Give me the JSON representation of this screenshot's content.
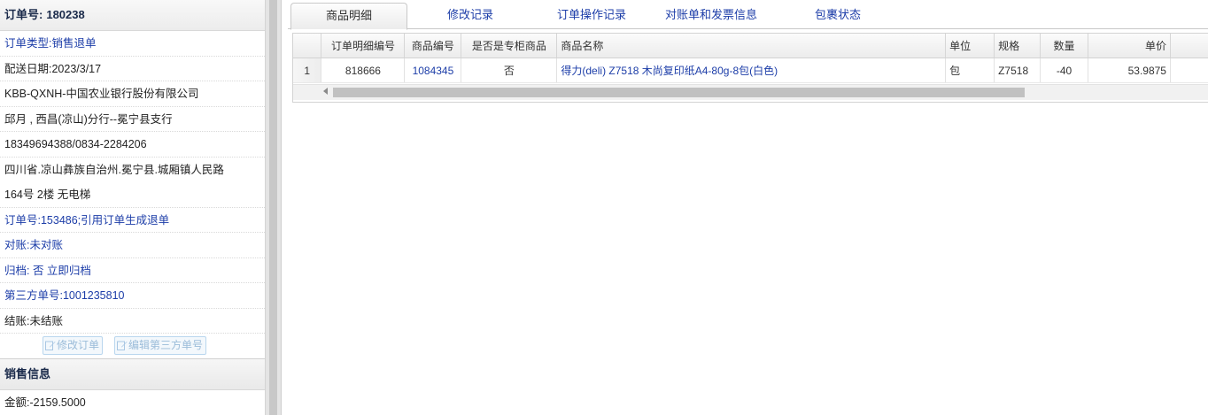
{
  "order_panel": {
    "order_no_label": "订单号:",
    "order_no": "180238",
    "rows": [
      "订单类型:销售退单",
      "配送日期:2023/3/17",
      "KBB-QXNH-中国农业银行股份有限公司",
      "邱月 , 西昌(凉山)分行--冕宁县支行",
      "18349694388/0834-2284206",
      "四川省.凉山彝族自治州.冕宁县.城厢镇人民路",
      "164号 2楼 无电梯",
      "订单号:153486;引用订单生成退单",
      "对账:未对账",
      "归档: 否 立即归档",
      "第三方单号:1001235810",
      "结账:未结账"
    ],
    "buttons": {
      "edit_order": "修改订单",
      "edit_third_party_no": "编辑第三方单号"
    }
  },
  "sales_panel": {
    "title": "销售信息",
    "amount": "金额:-2159.5000"
  },
  "tabs": [
    {
      "label": "商品明细",
      "active": true
    },
    {
      "label": "修改记录",
      "active": false
    },
    {
      "label": "订单操作记录",
      "active": false
    },
    {
      "label": "对账单和发票信息",
      "active": false
    },
    {
      "label": "包裹状态",
      "active": false
    }
  ],
  "grid": {
    "columns": [
      "订单明细编号",
      "商品编号",
      "是否是专柜商品",
      "商品名称",
      "单位",
      "规格",
      "数量",
      "单价"
    ],
    "rows": [
      {
        "row_no": "1",
        "detail_id": "818666",
        "product_code": "1084345",
        "is_counter": "否",
        "product_name": "得力(deli) Z7518 木尚复印纸A4-80g-8包(白色)",
        "unit": "包",
        "spec": "Z7518",
        "qty": "-40",
        "price": "53.9875"
      }
    ]
  },
  "colors": {
    "link": "#1c3da8",
    "header_text": "#1a2a4a",
    "button_disabled": "#9bbcd9"
  }
}
